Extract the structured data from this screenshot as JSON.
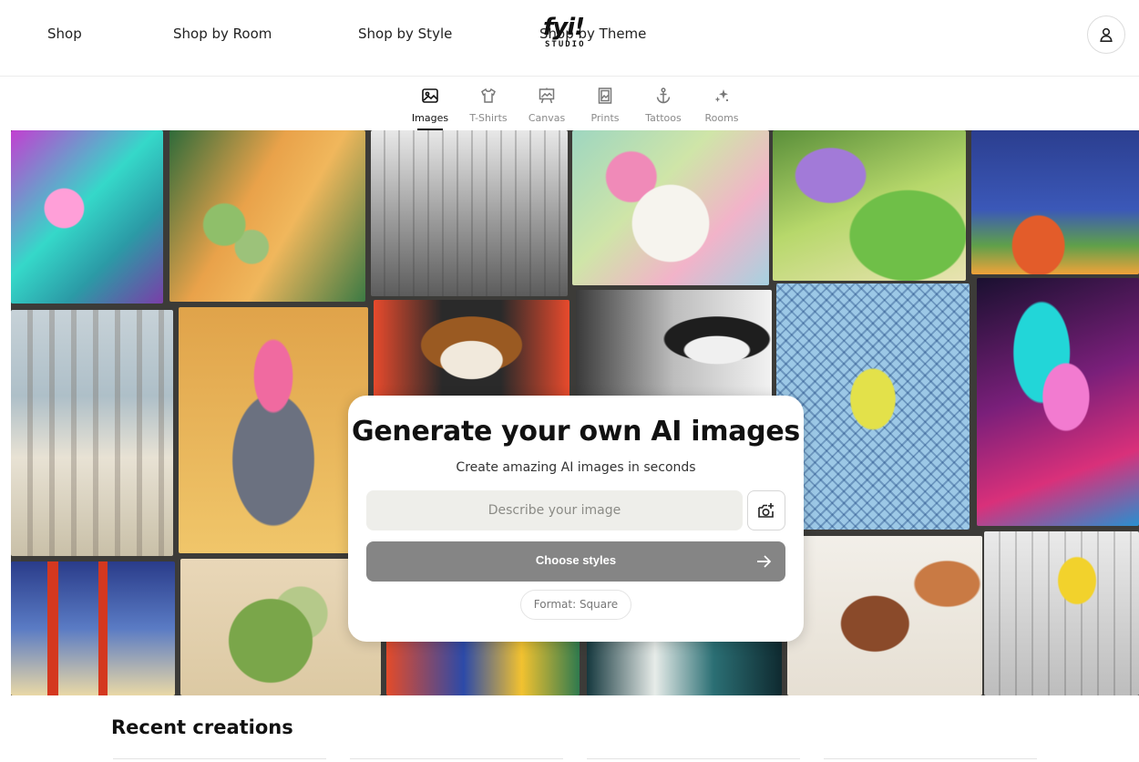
{
  "nav": {
    "links": [
      "Shop",
      "Shop by Room",
      "Shop by Style",
      "Shop by Theme"
    ],
    "logo_main": "fyi!",
    "logo_sub": "STUDIO"
  },
  "tabs": [
    {
      "label": "Images",
      "icon": "image-icon",
      "active": true
    },
    {
      "label": "T-Shirts",
      "icon": "tshirt-icon",
      "active": false
    },
    {
      "label": "Canvas",
      "icon": "easel-icon",
      "active": false
    },
    {
      "label": "Prints",
      "icon": "print-frame-icon",
      "active": false
    },
    {
      "label": "Tattoos",
      "icon": "anchor-icon",
      "active": false
    },
    {
      "label": "Rooms",
      "icon": "sparkle-icon",
      "active": false
    }
  ],
  "generator": {
    "title": "Generate your own AI images",
    "subtitle": "Create amazing AI images in seconds",
    "prompt_placeholder": "Describe your image",
    "prompt_value": "",
    "choose_styles_label": "Choose styles",
    "format_label": "Format: Square"
  },
  "recent": {
    "title": "Recent creations"
  },
  "colors": {
    "accent_button": "#858585",
    "input_bg": "#eeeeea",
    "hero_bg": "#3c3b38"
  }
}
